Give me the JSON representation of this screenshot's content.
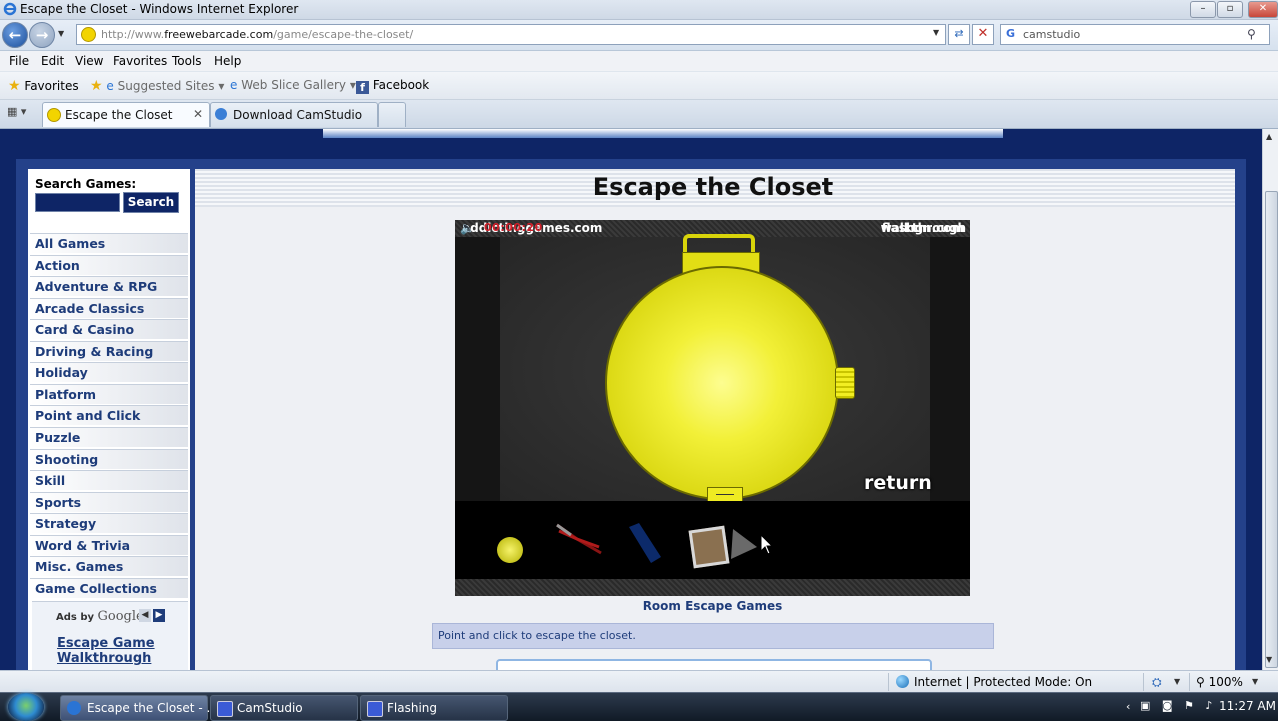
{
  "window": {
    "title": "Escape the Closet - Windows Internet Explorer"
  },
  "address_bar": {
    "url_prefix": "http://www.",
    "url_domain": "freewebarcade.com",
    "url_path": "/game/escape-the-closet/"
  },
  "search_box": {
    "query": "camstudio",
    "provider_icon": "G"
  },
  "menu": [
    "File",
    "Edit",
    "View",
    "Favorites",
    "Tools",
    "Help"
  ],
  "favorites_bar": {
    "favorites": "Favorites",
    "suggested": "Suggested Sites",
    "slice": "Web Slice Gallery",
    "facebook": "Facebook"
  },
  "tabs": [
    {
      "label": "Escape the Closet"
    },
    {
      "label": "Download CamStudio"
    }
  ],
  "sidebar": {
    "search_label": "Search Games:",
    "search_button": "Search",
    "categories": [
      "All Games",
      "Action",
      "Adventure & RPG",
      "Arcade Classics",
      "Card & Casino",
      "Driving & Racing",
      "Holiday",
      "Platform",
      "Point and Click",
      "Puzzle",
      "Shooting",
      "Skill",
      "Sports",
      "Strategy",
      "Word & Trivia",
      "Misc. Games",
      "Game Collections"
    ],
    "ads_by": "Ads by",
    "ads_google": "Google",
    "ad_link": "Escape Game Walkthrough"
  },
  "main": {
    "title": "Escape the Closet",
    "game": {
      "site_left": "addictinggames.com",
      "site_right": "flashgn.com",
      "return_label": "return",
      "timer": "00:00:20",
      "walkthrough": "walkthrough"
    },
    "caption": "Room Escape Games",
    "instructions": "Point and click to escape the closet."
  },
  "status_bar": {
    "zone": "Internet | Protected Mode: On",
    "zoom": "100%"
  },
  "taskbar": {
    "items": [
      {
        "label": "Escape the Closet - ..."
      },
      {
        "label": "CamStudio"
      },
      {
        "label": "Flashing"
      }
    ],
    "clock": "11:27 AM"
  },
  "colors": {
    "page_navy": "#0e2566",
    "link_blue": "#1e3c7a",
    "watch_yellow": "#f2f038",
    "timer_red": "#d0202a"
  }
}
